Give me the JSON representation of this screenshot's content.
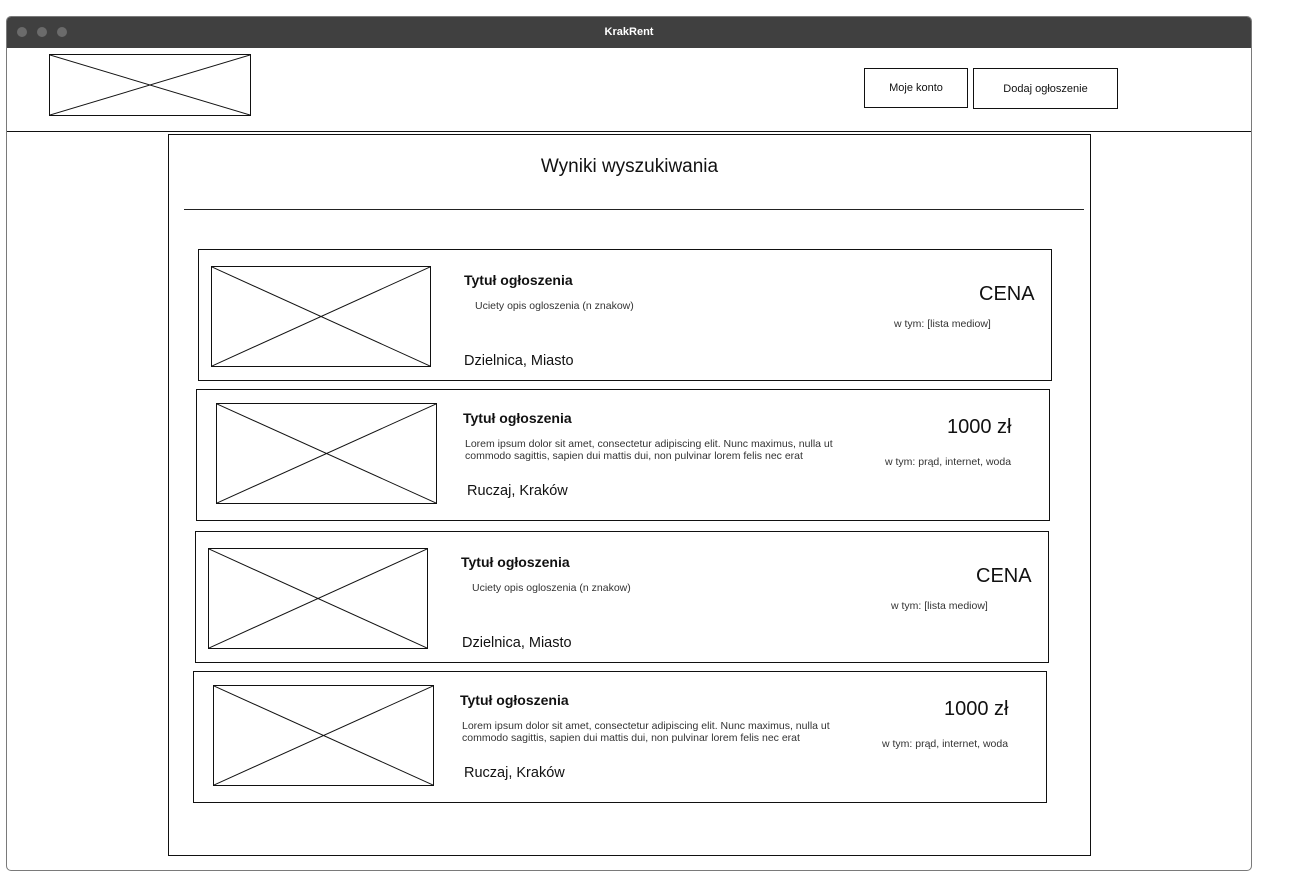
{
  "window": {
    "title": "KrakRent"
  },
  "header": {
    "account_label": "Moje konto",
    "add_listing_label": "Dodaj ogłoszenie"
  },
  "results": {
    "title": "Wyniki wyszukiwania",
    "listings": [
      {
        "title": "Tytuł ogłoszenia",
        "description": "Uciety opis ogloszenia (n znakow)",
        "location": "Dzielnica, Miasto",
        "price": "CENA",
        "includes": "w tym: [lista mediow]"
      },
      {
        "title": "Tytuł ogłoszenia",
        "description": "Lorem ipsum dolor sit amet, consectetur adipiscing elit. Nunc maximus, nulla ut commodo sagittis, sapien dui mattis dui, non pulvinar lorem felis nec erat",
        "location": "Ruczaj, Kraków",
        "price": "1000 zł",
        "includes": "w tym: prąd, internet, woda"
      },
      {
        "title": "Tytuł ogłoszenia",
        "description": "Uciety opis ogloszenia (n znakow)",
        "location": "Dzielnica, Miasto",
        "price": "CENA",
        "includes": "w tym: [lista mediow]"
      },
      {
        "title": "Tytuł ogłoszenia",
        "description": "Lorem ipsum dolor sit amet, consectetur adipiscing elit. Nunc maximus, nulla ut commodo sagittis, sapien dui mattis dui, non pulvinar lorem felis nec erat",
        "location": "Ruczaj, Kraków",
        "price": "1000 zł",
        "includes": "w tym: prąd, internet, woda"
      }
    ]
  }
}
